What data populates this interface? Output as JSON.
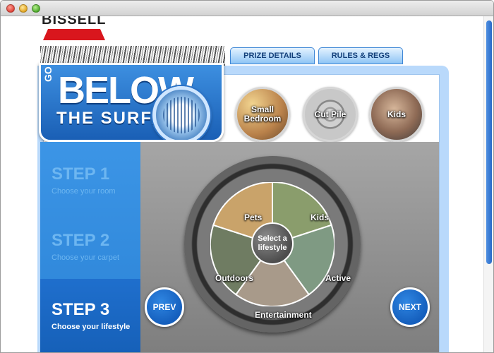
{
  "brand": {
    "logo_text": "BISSELL"
  },
  "tabs": {
    "prize_details": "PRIZE DETAILS",
    "rules_regs": "RULES & REGS"
  },
  "header": {
    "go": "GO",
    "below": "BELOW",
    "surface": "THE SURFACE"
  },
  "carpet_options": [
    {
      "label": "Small Bedroom",
      "icon": "bedroom-photo"
    },
    {
      "label": "Cut Pile",
      "icon": "carpet-texture"
    },
    {
      "label": "Kids",
      "icon": "kids-photo"
    }
  ],
  "steps": [
    {
      "title": "STEP 1",
      "description": "Choose your room",
      "active": false
    },
    {
      "title": "STEP 2",
      "description": "Choose your carpet",
      "active": false
    },
    {
      "title": "STEP 3",
      "description": "Choose your lifestyle",
      "active": true
    }
  ],
  "wheel": {
    "center_label": "Select a lifestyle",
    "segments": [
      "Pets",
      "Kids",
      "Active",
      "Entertainment",
      "Outdoors"
    ]
  },
  "nav": {
    "prev": "PREV",
    "next": "NEXT"
  },
  "colors": {
    "brand_red": "#d9161d",
    "brand_blue": "#1f6fcd"
  }
}
